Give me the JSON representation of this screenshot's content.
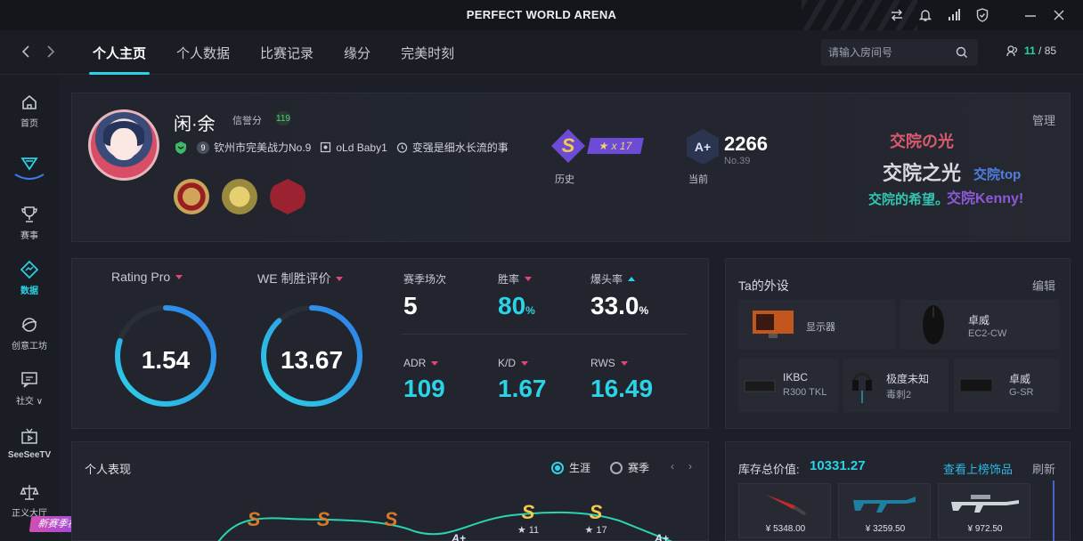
{
  "app": {
    "title": "PERFECT WORLD ARENA",
    "titlebar_icons": [
      "swap-icon",
      "bell-icon",
      "signal-icon",
      "shield-icon",
      "minimize-icon",
      "close-icon"
    ]
  },
  "nav": {
    "tabs": [
      {
        "label": "个人主页",
        "active": true
      },
      {
        "label": "个人数据",
        "active": false
      },
      {
        "label": "比赛记录",
        "active": false
      },
      {
        "label": "缘分",
        "active": false
      },
      {
        "label": "完美时刻",
        "active": false
      }
    ],
    "search_placeholder": "请输入房间号",
    "counter_current": "11",
    "counter_sep": " / ",
    "counter_total": "85"
  },
  "sidebar": {
    "items": [
      {
        "label": "首页",
        "icon": "home-icon",
        "active": false
      },
      {
        "label": "",
        "icon": "logo-icon",
        "active": false
      },
      {
        "label": "赛事",
        "icon": "trophy-icon",
        "active": false
      },
      {
        "label": "数据",
        "icon": "data-icon",
        "active": true
      },
      {
        "label": "创意工坊",
        "icon": "workshop-icon",
        "active": false
      },
      {
        "label": "社交 ∨",
        "icon": "social-icon",
        "active": false
      },
      {
        "label": "SeeSeeTV",
        "icon": "tv-icon",
        "active": false
      },
      {
        "label": "正义大厅",
        "icon": "scales-icon",
        "active": false
      }
    ],
    "badge": "新赛季福利"
  },
  "profile": {
    "username": "闲·余",
    "credit_label": "信誉分",
    "credit_value": "119",
    "level": "9",
    "team": "钦州市完美战力No.9",
    "clan": "oLd Baby1",
    "status": "变强是细水长流的事",
    "rank_history": {
      "badge": "S",
      "stars": "★ x 17",
      "caption": "历史"
    },
    "rank_current": {
      "badge": "A+",
      "score": "2266",
      "number": "No.39",
      "caption": "当前"
    },
    "manage_label": "管理",
    "signature": [
      "交院の光",
      "交院之光",
      "交院top",
      "交院的希望。",
      "交院Kenny!"
    ]
  },
  "stats": {
    "rating_pro": {
      "label": "Rating Pro",
      "value": "1.54",
      "fraction": 0.8
    },
    "we_rating": {
      "label": "WE 制胜评价",
      "value": "13.67",
      "fraction": 0.88
    },
    "matches": {
      "label": "赛季场次",
      "value": "5"
    },
    "win_rate": {
      "label": "胜率",
      "value": "80",
      "unit": "%"
    },
    "headshot": {
      "label": "爆头率",
      "value": "33.0",
      "unit": "%"
    },
    "adr": {
      "label": "ADR",
      "value": "109"
    },
    "kd": {
      "label": "K/D",
      "value": "1.67"
    },
    "rws": {
      "label": "RWS",
      "value": "16.49"
    }
  },
  "gear": {
    "title": "Ta的外设",
    "edit_label": "编辑",
    "items": [
      {
        "name": "显示器",
        "sub": ""
      },
      {
        "name": "卓威",
        "sub": "EC2-CW"
      },
      {
        "name": "IKBC",
        "sub": "R300 TKL"
      },
      {
        "name": "极度未知",
        "sub": "毒刺2"
      },
      {
        "name": "卓威",
        "sub": "G-SR"
      }
    ]
  },
  "performance": {
    "title": "个人表现",
    "option_career": "生涯",
    "option_season": "赛季",
    "prev_label": "‹",
    "next_label": "›",
    "points": [
      {
        "badge": "S",
        "stars": ""
      },
      {
        "badge": "S",
        "stars": ""
      },
      {
        "badge": "S",
        "stars": ""
      },
      {
        "badge": "A+",
        "stars": ""
      },
      {
        "badge": "S",
        "stars": "★ 11"
      },
      {
        "badge": "S",
        "stars": "★ 17"
      },
      {
        "badge": "A+",
        "stars": ""
      }
    ]
  },
  "inventory": {
    "title": "库存总价值:",
    "total": "10331.27",
    "link": "查看上榜饰品",
    "refresh": "刷新",
    "items": [
      {
        "price": "¥ 5348.00"
      },
      {
        "price": "¥ 3259.50"
      },
      {
        "price": "¥ 972.50"
      }
    ]
  }
}
